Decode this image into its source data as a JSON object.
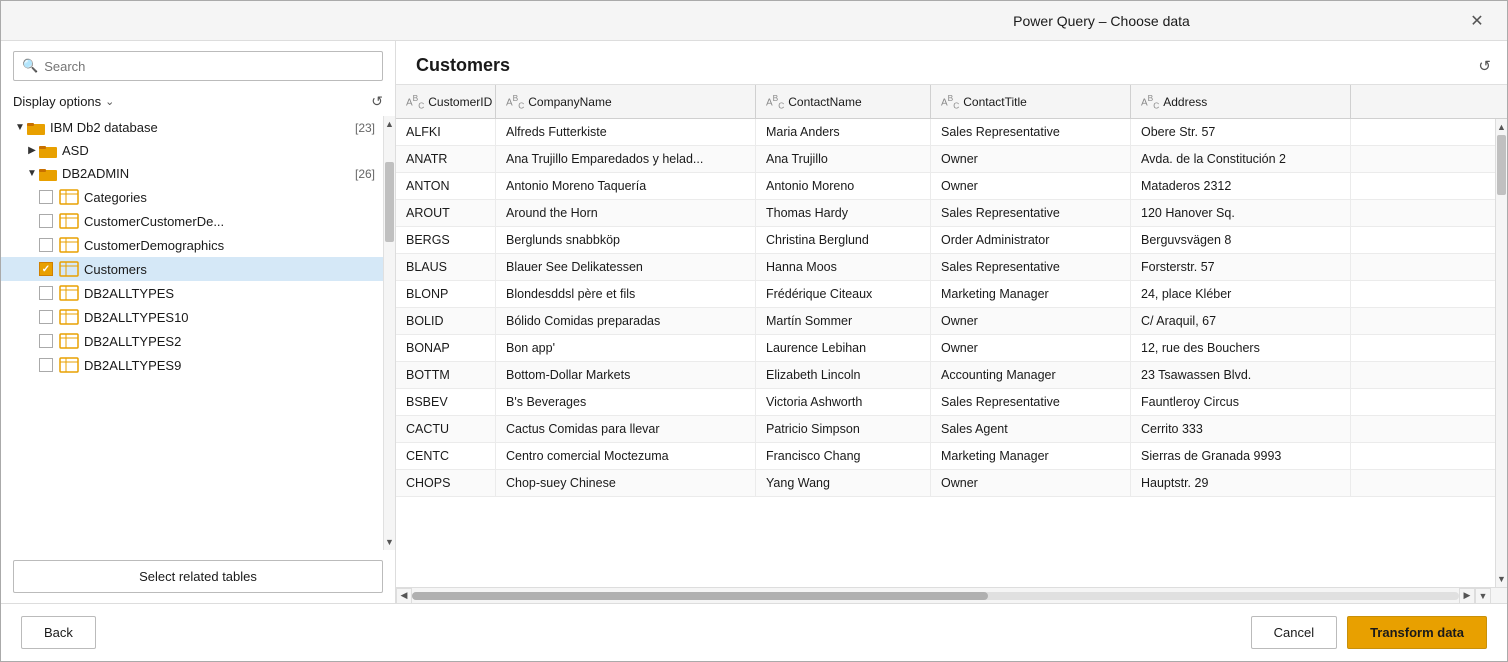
{
  "dialog": {
    "title": "Power Query – Choose data",
    "close_label": "✕"
  },
  "left_panel": {
    "search_placeholder": "Search",
    "display_options_label": "Display options",
    "refresh_tooltip": "Refresh",
    "tree": {
      "root": {
        "label": "IBM Db2 database",
        "count": "[23]",
        "children": [
          {
            "label": "ASD",
            "expanded": false,
            "children": []
          },
          {
            "label": "DB2ADMIN",
            "count": "[26]",
            "expanded": true,
            "children": [
              {
                "label": "Categories",
                "checked": false,
                "selected": false
              },
              {
                "label": "CustomerCustomerDe...",
                "checked": false,
                "selected": false
              },
              {
                "label": "CustomerDemographics",
                "checked": false,
                "selected": false
              },
              {
                "label": "Customers",
                "checked": true,
                "selected": true
              },
              {
                "label": "DB2ALLTYPES",
                "checked": false,
                "selected": false
              },
              {
                "label": "DB2ALLTYPES10",
                "checked": false,
                "selected": false
              },
              {
                "label": "DB2ALLTYPES2",
                "checked": false,
                "selected": false
              },
              {
                "label": "DB2ALLTYPES9",
                "checked": false,
                "selected": false
              }
            ]
          }
        ]
      }
    },
    "select_related_tables_label": "Select related tables",
    "back_label": "Back"
  },
  "right_panel": {
    "table_name": "Customers",
    "columns": [
      {
        "name": "CustomerID",
        "type": "ABC"
      },
      {
        "name": "CompanyName",
        "type": "ABC"
      },
      {
        "name": "ContactName",
        "type": "ABC"
      },
      {
        "name": "ContactTitle",
        "type": "ABC"
      },
      {
        "name": "Address",
        "type": "ABC"
      }
    ],
    "rows": [
      {
        "CustomerID": "ALFKI",
        "CompanyName": "Alfreds Futterkiste",
        "ContactName": "Maria Anders",
        "ContactTitle": "Sales Representative",
        "Address": "Obere Str. 57"
      },
      {
        "CustomerID": "ANATR",
        "CompanyName": "Ana Trujillo Emparedados y helad...",
        "ContactName": "Ana Trujillo",
        "ContactTitle": "Owner",
        "Address": "Avda. de la Constitución 2"
      },
      {
        "CustomerID": "ANTON",
        "CompanyName": "Antonio Moreno Taquería",
        "ContactName": "Antonio Moreno",
        "ContactTitle": "Owner",
        "Address": "Mataderos 2312"
      },
      {
        "CustomerID": "AROUT",
        "CompanyName": "Around the Horn",
        "ContactName": "Thomas Hardy",
        "ContactTitle": "Sales Representative",
        "Address": "120 Hanover Sq."
      },
      {
        "CustomerID": "BERGS",
        "CompanyName": "Berglunds snabbköp",
        "ContactName": "Christina Berglund",
        "ContactTitle": "Order Administrator",
        "Address": "Berguvsvägen 8"
      },
      {
        "CustomerID": "BLAUS",
        "CompanyName": "Blauer See Delikatessen",
        "ContactName": "Hanna Moos",
        "ContactTitle": "Sales Representative",
        "Address": "Forsterstr. 57"
      },
      {
        "CustomerID": "BLONP",
        "CompanyName": "Blondesddsl père et fils",
        "ContactName": "Frédérique Citeaux",
        "ContactTitle": "Marketing Manager",
        "Address": "24, place Kléber"
      },
      {
        "CustomerID": "BOLID",
        "CompanyName": "Bólido Comidas preparadas",
        "ContactName": "Martín Sommer",
        "ContactTitle": "Owner",
        "Address": "C/ Araquil, 67"
      },
      {
        "CustomerID": "BONAP",
        "CompanyName": "Bon app'",
        "ContactName": "Laurence Lebihan",
        "ContactTitle": "Owner",
        "Address": "12, rue des Bouchers"
      },
      {
        "CustomerID": "BOTTM",
        "CompanyName": "Bottom-Dollar Markets",
        "ContactName": "Elizabeth Lincoln",
        "ContactTitle": "Accounting Manager",
        "Address": "23 Tsawassen Blvd."
      },
      {
        "CustomerID": "BSBEV",
        "CompanyName": "B's Beverages",
        "ContactName": "Victoria Ashworth",
        "ContactTitle": "Sales Representative",
        "Address": "Fauntleroy Circus"
      },
      {
        "CustomerID": "CACTU",
        "CompanyName": "Cactus Comidas para llevar",
        "ContactName": "Patricio Simpson",
        "ContactTitle": "Sales Agent",
        "Address": "Cerrito 333"
      },
      {
        "CustomerID": "CENTC",
        "CompanyName": "Centro comercial Moctezuma",
        "ContactName": "Francisco Chang",
        "ContactTitle": "Marketing Manager",
        "Address": "Sierras de Granada 9993"
      },
      {
        "CustomerID": "CHOPS",
        "CompanyName": "Chop-suey Chinese",
        "ContactName": "Yang Wang",
        "ContactTitle": "Owner",
        "Address": "Hauptstr. 29"
      }
    ],
    "cancel_label": "Cancel",
    "transform_label": "Transform data"
  },
  "colors": {
    "folder_orange": "#e8a000",
    "folder_dark": "#c87000",
    "checkbox_checked_bg": "#e8a000",
    "transform_btn_bg": "#e8a000",
    "selected_row_bg": "#e8e8e8"
  }
}
